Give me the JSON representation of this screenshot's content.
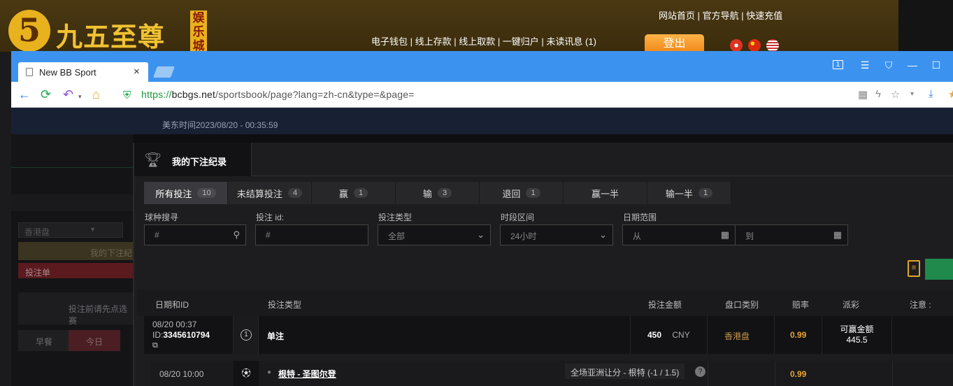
{
  "site": {
    "logo_digit": "5",
    "logo_text": "九五至尊",
    "logo_tag": "娱乐城",
    "top_links": "网站首页 | 官方导航 | 快速充值",
    "account_links": "电子钱包 | 线上存款 | 线上取款 | 一键归户 | 未读讯息 (1)",
    "logout_label": "登出",
    "flags": [
      "hk-flag-icon",
      "cn-flag-icon",
      "us-flag-icon"
    ]
  },
  "browser": {
    "tab_title": "New BB Sport",
    "tab_close": "×",
    "url_proto": "https://",
    "url_host": "bcbgs.net",
    "url_path": "/sportsbook/page?lang=zh-cn&type=&page="
  },
  "page": {
    "timestamp": "美东时间2023/08/20 - 00:35:59",
    "left": {
      "odds_select": "香港盘",
      "my_bets_link": "我的下注纪",
      "bet_slip": "投注单",
      "prompt": "投注前请先点选赛",
      "tab_early": "早餐",
      "tab_today": "今日"
    },
    "panel_title": "我的下注纪录",
    "filter_tabs": [
      {
        "label": "所有投注",
        "count": "10"
      },
      {
        "label": "未结算投注",
        "count": "4"
      },
      {
        "label": "赢",
        "count": "1"
      },
      {
        "label": "输",
        "count": "3"
      },
      {
        "label": "退回",
        "count": "1"
      },
      {
        "label": "赢一半",
        "count": ""
      },
      {
        "label": "输一半",
        "count": "1"
      }
    ],
    "filters": {
      "sport_label": "球种搜寻",
      "sport_placeholder": "#",
      "betid_label": "投注 id:",
      "betid_placeholder": "#",
      "bettype_label": "投注类型",
      "bettype_value": "全部",
      "period_label": "时段区间",
      "period_value": "24小时",
      "date_label": "日期范围",
      "date_from": "从",
      "date_to": "到"
    },
    "table": {
      "headers": [
        "日期和ID",
        "投注类型",
        "投注金额",
        "盘口类别",
        "赔率",
        "派彩",
        "注意 :"
      ],
      "row1": {
        "datetime": "08/20 00:37",
        "id_prefix": "ID:",
        "id": "3345610794",
        "legs": "1",
        "type": "单注",
        "amount": "450",
        "currency": "CNY",
        "market": "香港盘",
        "odds": "0.99",
        "payout_label": "可赢金额",
        "payout_value": "445.5"
      },
      "row2": {
        "datetime": "08/20 10:00",
        "match": "根特 - 圣图尔登",
        "selection": "全场亚洲让分 - 根特 (-1 / 1.5)",
        "odds": "0.99"
      }
    }
  }
}
